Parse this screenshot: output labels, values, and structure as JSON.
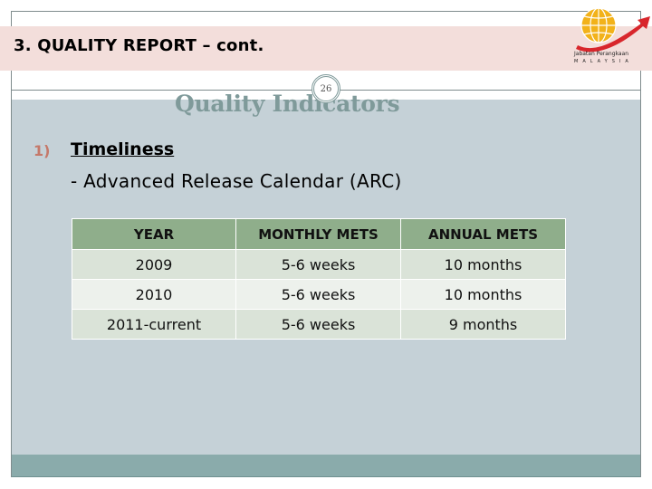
{
  "header": {
    "title": "3. QUALITY REPORT – cont.",
    "logo": {
      "icon": "globe-with-red-arrow-icon",
      "org_name": "Jabatan Perangkaan",
      "country": "MALAYSIA"
    }
  },
  "slide": {
    "page_number": "26",
    "section_title": "Quality Indicators"
  },
  "content": {
    "item_number": "1)",
    "item_heading": "Timeliness",
    "item_subtext": "- Advanced Release Calendar (ARC)"
  },
  "table": {
    "headers": [
      "YEAR",
      "MONTHLY METS",
      "ANNUAL METS"
    ],
    "rows": [
      [
        "2009",
        "5-6 weeks",
        "10 months"
      ],
      [
        "2010",
        "5-6 weeks",
        "10 months"
      ],
      [
        "2011-current",
        "5-6 weeks",
        "9 months"
      ]
    ]
  },
  "colors": {
    "title_band": "#f3dedb",
    "body_background": "#c5d1d7",
    "footer_band": "#8aabab",
    "section_title": "#7f9a9a",
    "list_number": "#c5796a",
    "table_header": "#8fae8b",
    "table_row_odd": "#dae3d8",
    "table_row_even": "#edf1ec"
  }
}
